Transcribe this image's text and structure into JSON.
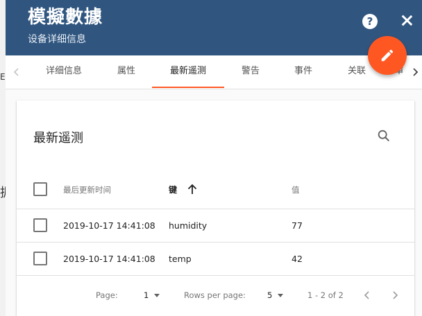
{
  "background": {
    "text1": "ER",
    "text2": "据"
  },
  "header": {
    "title": "模擬數據",
    "subtitle": "设备详细信息",
    "help_label": "?"
  },
  "tabs": [
    {
      "label": "详细信息",
      "active": false
    },
    {
      "label": "属性",
      "active": false
    },
    {
      "label": "最新遥测",
      "active": true
    },
    {
      "label": "警告",
      "active": false
    },
    {
      "label": "事件",
      "active": false
    },
    {
      "label": "关联",
      "active": false
    },
    {
      "label": "审",
      "active": false
    }
  ],
  "card": {
    "title": "最新遥测",
    "columns": {
      "last_update": "最后更新时间",
      "key": "键",
      "value": "值"
    },
    "rows": [
      {
        "time": "2019-10-17 14:41:08",
        "key": "humidity",
        "value": "77"
      },
      {
        "time": "2019-10-17 14:41:08",
        "key": "temp",
        "value": "42"
      }
    ],
    "footer": {
      "page_label": "Page:",
      "page_value": "1",
      "rows_label": "Rows per page:",
      "rows_value": "5",
      "range": "1 - 2 of 2"
    }
  },
  "colors": {
    "header_bg": "#305680",
    "accent": "#ff5722",
    "icons": [
      "help-icon",
      "close-icon",
      "edit-icon",
      "search-icon",
      "arrow-up-icon",
      "chevron-left-icon",
      "chevron-right-icon",
      "caret-down-icon"
    ]
  }
}
